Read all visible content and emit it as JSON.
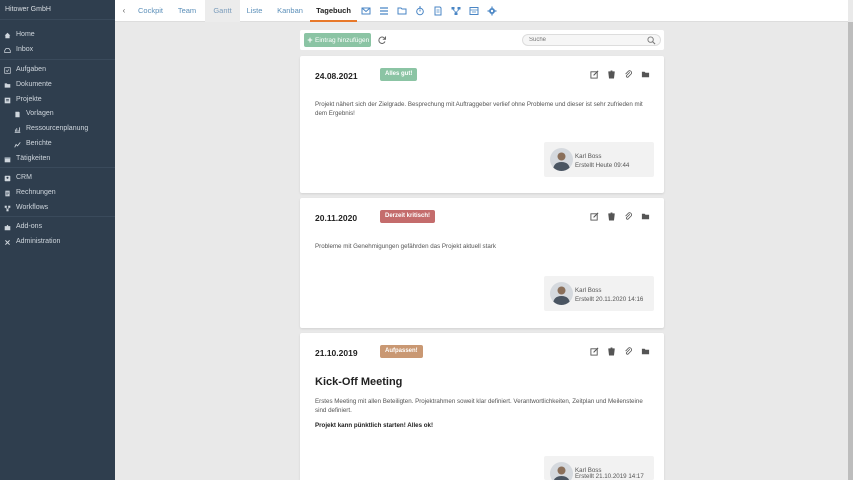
{
  "sidebar": {
    "company": "Hitower GmbH",
    "items": [
      {
        "label": "Home",
        "icon": "home-icon"
      },
      {
        "label": "Inbox",
        "icon": "inbox-icon"
      },
      {
        "label": "Aufgaben",
        "icon": "tasks-icon"
      },
      {
        "label": "Dokumente",
        "icon": "folder-icon"
      },
      {
        "label": "Projekte",
        "icon": "projects-icon"
      },
      {
        "label": "Vorlagen",
        "icon": "template-icon"
      },
      {
        "label": "Ressourcenplanung",
        "icon": "chart-icon"
      },
      {
        "label": "Berichte",
        "icon": "report-icon"
      },
      {
        "label": "Tätigkeiten",
        "icon": "calendar-icon"
      },
      {
        "label": "CRM",
        "icon": "crm-icon"
      },
      {
        "label": "Rechnungen",
        "icon": "invoice-icon"
      },
      {
        "label": "Workflows",
        "icon": "workflow-icon"
      },
      {
        "label": "Add-ons",
        "icon": "puzzle-icon"
      },
      {
        "label": "Administration",
        "icon": "wrench-icon"
      }
    ]
  },
  "tabs": {
    "cockpit": "Cockpit",
    "team": "Team",
    "gantt": "Gantt",
    "liste": "Liste",
    "kanban": "Kanban",
    "tagebuch": "Tagebuch"
  },
  "toolbar": {
    "add_label": "Eintrag hinzufügen",
    "search_placeholder": "Suche"
  },
  "entries": [
    {
      "date": "24.08.2021",
      "badge": "Alles gut!",
      "badge_color": "#8bc4a4",
      "text": "Projekt nähert sich der Zielgrade. Besprechung mit Auftraggeber verlief ohne Probleme und dieser ist sehr zufrieden mit dem Ergebnis!",
      "author": "Karl Boss",
      "created": "Erstellt Heute 09:44"
    },
    {
      "date": "20.11.2020",
      "badge": "Derzeit kritisch!",
      "badge_color": "#c46c6c",
      "text": "Probleme mit Genehmigungen gefährden das Projekt aktuell stark",
      "author": "Karl Boss",
      "created": "Erstellt 20.11.2020 14:16"
    },
    {
      "date": "21.10.2019",
      "badge": "Aufpassen!",
      "badge_color": "#c99873",
      "heading": "Kick-Off Meeting",
      "text": "Erstes Meeting mit allen Beteiligten. Projektrahmen soweit klar definiert. Verantwortlichkeiten, Zeitplan und Meilensteine sind definiert.",
      "bold_text": "Projekt kann pünktlich starten! Alles ok!",
      "author": "Karl Boss",
      "created": "Erstellt 21.10.2019 14:17"
    }
  ],
  "colors": {
    "sidebar_bg": "#2f3e4e",
    "accent": "#e8792b",
    "link": "#5b8fb9"
  }
}
